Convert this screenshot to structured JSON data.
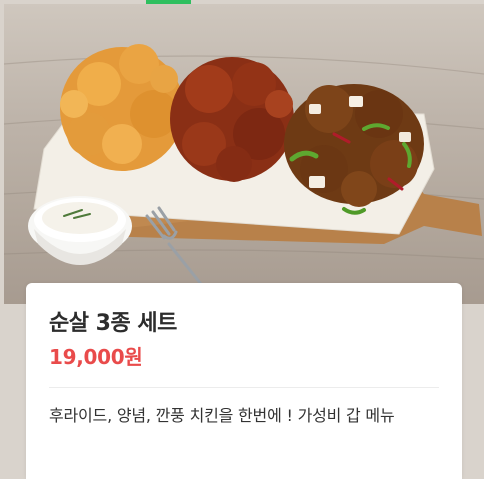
{
  "product": {
    "image_alt": "순살 3종 세트",
    "name": "순살 3종 세트",
    "price": "19,000원",
    "description": "후라이드, 양념, 깐풍 치킨을 한번에 ! 가성비 갑 메뉴"
  },
  "colors": {
    "price": "#e94b4b",
    "indicator": "#2fbf5f"
  }
}
